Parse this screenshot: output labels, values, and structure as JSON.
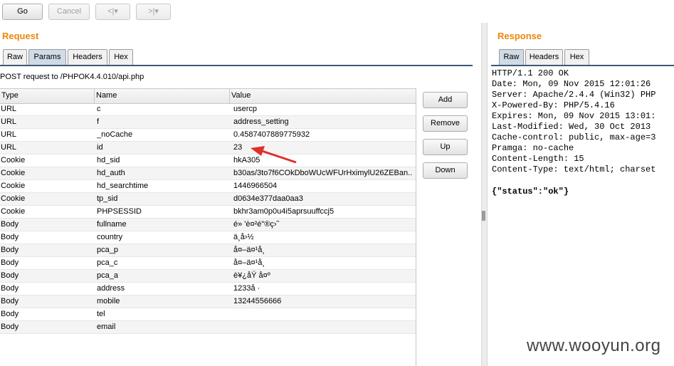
{
  "toolbar": {
    "go": "Go",
    "cancel": "Cancel",
    "back": "<|▾",
    "forward": ">|▾"
  },
  "request": {
    "title": "Request",
    "tabs": [
      "Raw",
      "Params",
      "Headers",
      "Hex"
    ],
    "active_tab": "Params",
    "summary": "POST request to /PHPOK4.4.010/api.php",
    "columns": [
      "Type",
      "Name",
      "Value"
    ],
    "rows": [
      {
        "type": "URL",
        "name": "c",
        "value": "usercp"
      },
      {
        "type": "URL",
        "name": "f",
        "value": "address_setting"
      },
      {
        "type": "URL",
        "name": "_noCache",
        "value": "0.4587407889775932"
      },
      {
        "type": "URL",
        "name": "id",
        "value": "23"
      },
      {
        "type": "Cookie",
        "name": "hd_sid",
        "value": "hkA305"
      },
      {
        "type": "Cookie",
        "name": "hd_auth",
        "value": "b30as/3to7f6COkDboWUcWFUrHximylU26ZEBan..."
      },
      {
        "type": "Cookie",
        "name": "hd_searchtime",
        "value": "1446966504"
      },
      {
        "type": "Cookie",
        "name": "tp_sid",
        "value": "d0634e377daa0aa3"
      },
      {
        "type": "Cookie",
        "name": "PHPSESSID",
        "value": "bkhr3am0p0u4i5aprsuuffccj5"
      },
      {
        "type": "Body",
        "name": "fullname",
        "value": "é» 'è¤²é\"®ç›˜"
      },
      {
        "type": "Body",
        "name": "country",
        "value": "ä¸­å›½"
      },
      {
        "type": "Body",
        "name": "pca_p",
        "value": "å¤–ä¤¹å¸"
      },
      {
        "type": "Body",
        "name": "pca_c",
        "value": "å¤–ä¤¹å¸"
      },
      {
        "type": "Body",
        "name": "pca_a",
        "value": "è¥¿åŸ å¤º"
      },
      {
        "type": "Body",
        "name": "address",
        "value": "1233å ·"
      },
      {
        "type": "Body",
        "name": "mobile",
        "value": "13244556666"
      },
      {
        "type": "Body",
        "name": "tel",
        "value": ""
      },
      {
        "type": "Body",
        "name": "email",
        "value": ""
      }
    ],
    "buttons": [
      "Add",
      "Remove",
      "Up",
      "Down"
    ]
  },
  "response": {
    "title": "Response",
    "tabs": [
      "Raw",
      "Headers",
      "Hex"
    ],
    "active_tab": "Raw",
    "headers": "HTTP/1.1 200 OK\nDate: Mon, 09 Nov 2015 12:01:26\nServer: Apache/2.4.4 (Win32) PHP\nX-Powered-By: PHP/5.4.16\nExpires: Mon, 09 Nov 2015 13:01:\nLast-Modified: Wed, 30 Oct 2013\nCache-control: public, max-age=3\nPramga: no-cache\nContent-Length: 15\nContent-Type: text/html; charset",
    "body": "{\"status\":\"ok\"}"
  },
  "watermark": "www.wooyun.org",
  "colors": {
    "section_title": "#e8890c",
    "active_tab": "#cfdbe6",
    "arrow": "#e0302a"
  }
}
